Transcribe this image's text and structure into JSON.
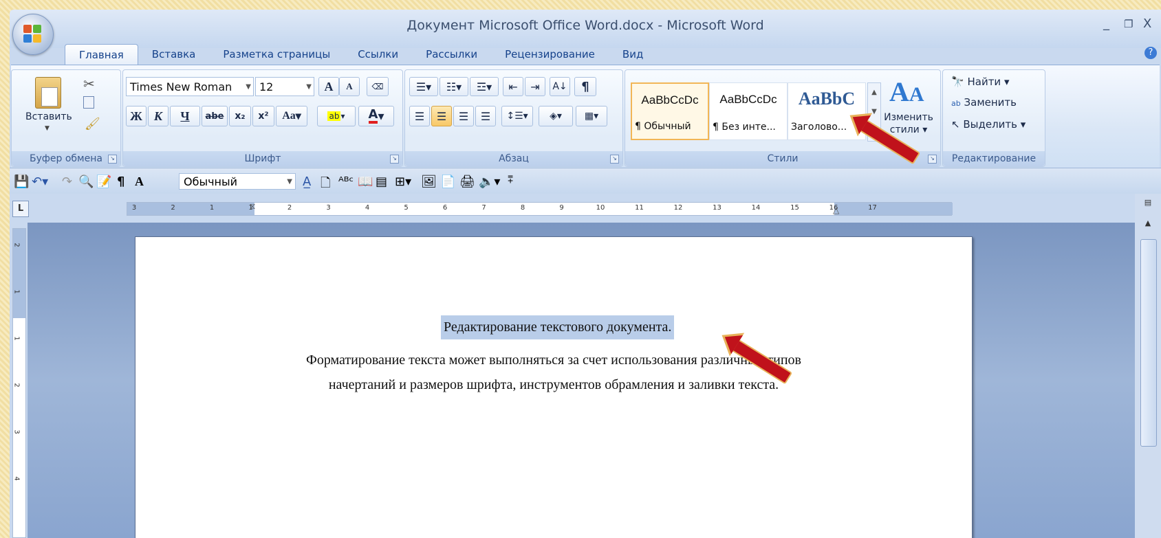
{
  "window": {
    "title": "Документ Microsoft Office Word.docx - Microsoft Word",
    "controls": [
      "_",
      "❐",
      "X"
    ]
  },
  "tabs": [
    "Главная",
    "Вставка",
    "Разметка страницы",
    "Ссылки",
    "Рассылки",
    "Рецензирование",
    "Вид"
  ],
  "active_tab": "Главная",
  "clipboard": {
    "paste_label": "Вставить",
    "group_label": "Буфер обмена"
  },
  "font": {
    "name": "Times New Roman",
    "size": "12",
    "group_label": "Шрифт",
    "bold": "Ж",
    "italic": "К",
    "underline": "Ч",
    "strike": "abe",
    "subscript": "x₂",
    "superscript": "x²",
    "case": "Aa",
    "grow": "A",
    "shrink": "A",
    "highlight": "ab",
    "color": "A"
  },
  "paragraph": {
    "group_label": "Абзац",
    "pilcrow": "¶"
  },
  "styles": {
    "group_label": "Стили",
    "cards": [
      {
        "sample": "AaBbCcDc",
        "name": "¶ Обычный"
      },
      {
        "sample": "AaBbCcDc",
        "name": "¶ Без инте..."
      },
      {
        "sample": "AaBbC",
        "name": "Заголово..."
      }
    ],
    "change_label_1": "Изменить",
    "change_label_2": "стили"
  },
  "editing": {
    "group_label": "Редактирование",
    "find": "Найти",
    "replace": "Заменить",
    "select": "Выделить"
  },
  "qat": {
    "style_value": "Обычный"
  },
  "ruler": {
    "corner": "L",
    "ticks": [
      "3",
      "2",
      "1",
      "1",
      "2",
      "3",
      "4",
      "5",
      "6",
      "7",
      "8",
      "9",
      "10",
      "11",
      "12",
      "13",
      "14",
      "15",
      "16",
      "17"
    ],
    "vticks": [
      "2",
      "1",
      "1",
      "2",
      "3",
      "4"
    ]
  },
  "document": {
    "heading": "Редактирование текстового документа.",
    "para_line1": "Форматирование текста может выполняться за счет использования различных типов",
    "para_line2": "начертаний и размеров шрифта, инструментов обрамления и заливки текста."
  },
  "colors": {
    "accent": "#15428b",
    "selection": "#b9cde9",
    "arrow": "#c0121b"
  }
}
